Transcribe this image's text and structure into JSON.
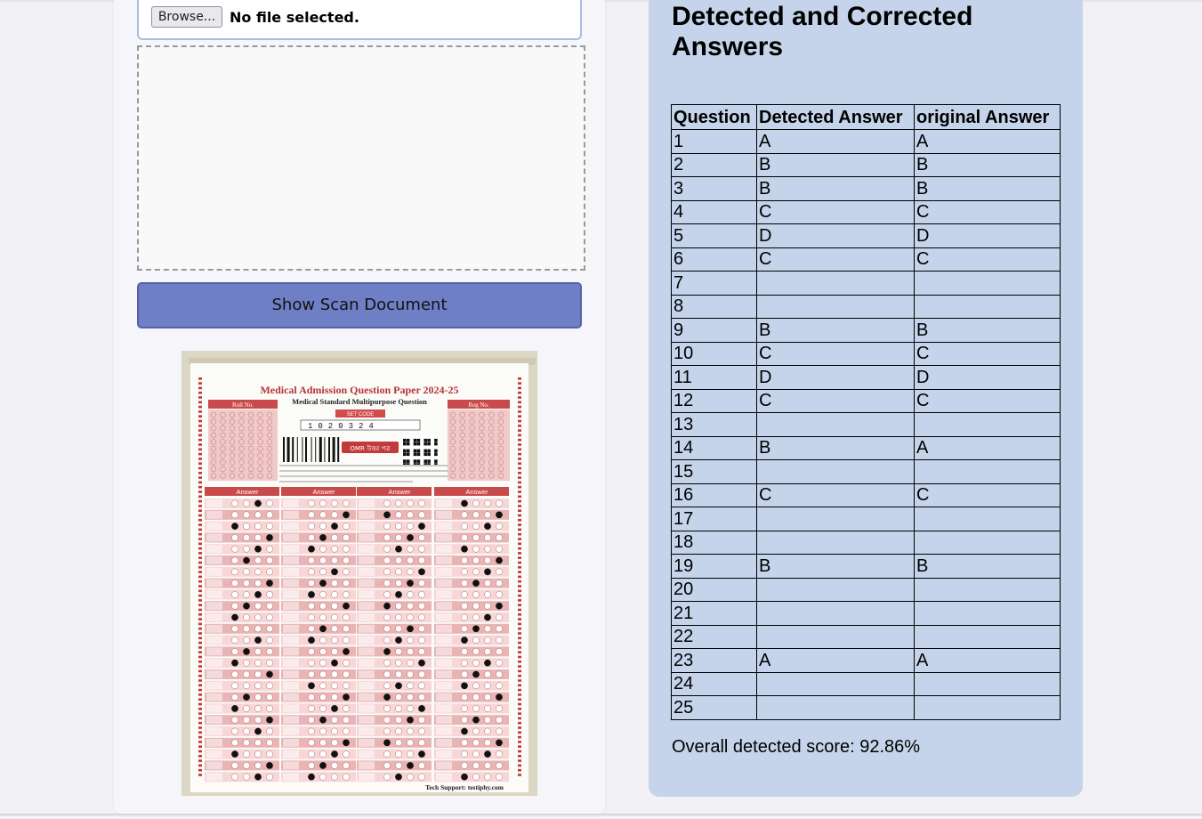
{
  "upload": {
    "browse_label": "Browse...",
    "status": "No file selected."
  },
  "scan_button": "Show Scan Document",
  "omr_sheet": {
    "title": "Medical Admission Question Paper 2024-25",
    "subtitle": "Medical Standard Multipurpose Question",
    "set_code_label": "SET CODE",
    "roll_label": "Roll No.",
    "reg_label": "Reg No.",
    "code_digits": "1020324",
    "omr_badge": "OMR উত্তর পত্র",
    "col_q_header": "Q No.",
    "col_answer_header": "Answer",
    "footer": "Tech Support: testiphy.com"
  },
  "results": {
    "title": "Detected and Corrected Answers",
    "headers": [
      "Question",
      "Detected Answer",
      "original Answer"
    ],
    "rows": [
      [
        "1",
        "A",
        "A"
      ],
      [
        "2",
        "B",
        "B"
      ],
      [
        "3",
        "B",
        "B"
      ],
      [
        "4",
        "C",
        "C"
      ],
      [
        "5",
        "D",
        "D"
      ],
      [
        "6",
        "C",
        "C"
      ],
      [
        "7",
        "",
        ""
      ],
      [
        "8",
        "",
        ""
      ],
      [
        "9",
        "B",
        "B"
      ],
      [
        "10",
        "C",
        "C"
      ],
      [
        "11",
        "D",
        "D"
      ],
      [
        "12",
        "C",
        "C"
      ],
      [
        "13",
        "",
        ""
      ],
      [
        "14",
        "B",
        "A"
      ],
      [
        "15",
        "",
        ""
      ],
      [
        "16",
        "C",
        "C"
      ],
      [
        "17",
        "",
        ""
      ],
      [
        "18",
        "",
        ""
      ],
      [
        "19",
        "B",
        "B"
      ],
      [
        "20",
        "",
        ""
      ],
      [
        "21",
        "",
        ""
      ],
      [
        "22",
        "",
        ""
      ],
      [
        "23",
        "A",
        "A"
      ],
      [
        "24",
        "",
        ""
      ],
      [
        "25",
        "",
        ""
      ]
    ],
    "score_text": "Overall detected score: 92.86%"
  },
  "colors": {
    "panel_bg": "#c5d4ea",
    "button_bg": "#6f7fc6",
    "omr_red": "#c0393b"
  }
}
